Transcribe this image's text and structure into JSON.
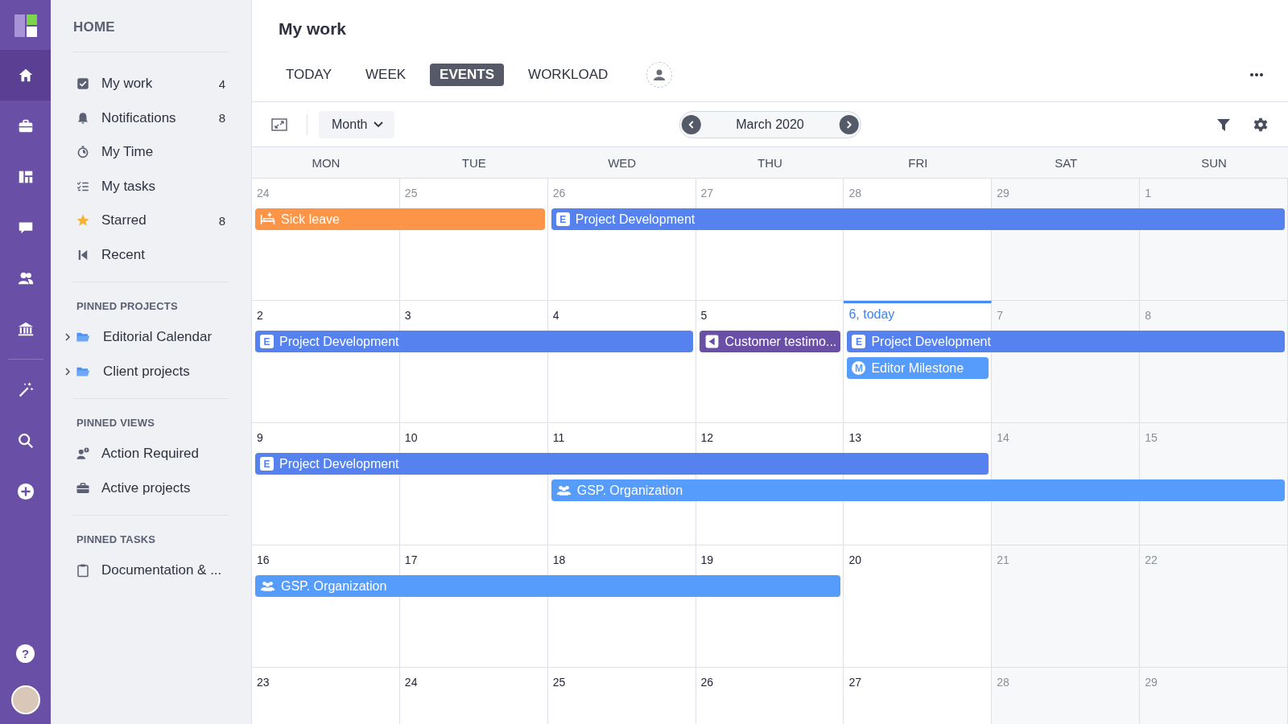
{
  "rail": {
    "items": [
      {
        "selected": true
      },
      {
        "selected": false
      },
      {
        "selected": false
      },
      {
        "selected": false
      },
      {
        "selected": false
      },
      {
        "selected": false
      },
      {
        "selected": false
      },
      {
        "selected": false
      },
      {
        "selected": false
      }
    ],
    "help": "?"
  },
  "sidebar": {
    "sections": [
      {
        "title": "HOME",
        "items": [
          {
            "label": "My work",
            "count": "4"
          },
          {
            "label": "Notifications",
            "count": "8"
          },
          {
            "label": "My Time"
          },
          {
            "label": "My tasks"
          },
          {
            "label": "Starred",
            "count": "8"
          },
          {
            "label": "Recent"
          }
        ]
      },
      {
        "title": "PINNED PROJECTS",
        "items": [
          {
            "label": "Editorial Calendar",
            "expanded": false
          },
          {
            "label": "Client projects",
            "expanded": false
          }
        ]
      },
      {
        "title": "PINNED VIEWS",
        "items": [
          {
            "label": "Action Required"
          },
          {
            "label": "Active projects"
          }
        ]
      },
      {
        "title": "PINNED TASKS",
        "items": [
          {
            "label": "Documentation & ..."
          }
        ]
      }
    ]
  },
  "page": {
    "title": "My work"
  },
  "tabs": [
    {
      "label": "TODAY",
      "selected": false
    },
    {
      "label": "WEEK",
      "selected": false
    },
    {
      "label": "EVENTS",
      "selected": true
    },
    {
      "label": "WORKLOAD",
      "selected": false
    }
  ],
  "toolbar": {
    "view": "Month",
    "period": "March 2020"
  },
  "calendar": {
    "weekdays": [
      "MON",
      "TUE",
      "WED",
      "THU",
      "FRI",
      "SAT",
      "SUN"
    ],
    "weeks": [
      {
        "days": [
          {
            "label": "24",
            "muted": true
          },
          {
            "label": "25",
            "muted": true
          },
          {
            "label": "26",
            "muted": true
          },
          {
            "label": "27",
            "muted": true
          },
          {
            "label": "28",
            "muted": true
          },
          {
            "label": "29",
            "muted": true
          },
          {
            "label": "1",
            "muted": true
          }
        ],
        "lanes": [
          [
            {
              "kind": "leave",
              "title": "Sick leave",
              "color": "#fd9549"
            },
            {
              "kind": "continued"
            },
            {
              "kind": "epic",
              "badge": "E",
              "title": "Project Development",
              "color": "#5582ef"
            },
            {
              "kind": "continued"
            },
            {
              "kind": "continued"
            },
            {
              "kind": "continued"
            },
            {
              "kind": "continued"
            }
          ]
        ]
      },
      {
        "days": [
          {
            "label": "2",
            "muted": false
          },
          {
            "label": "3",
            "muted": false
          },
          {
            "label": "4",
            "muted": false
          },
          {
            "label": "5",
            "muted": false
          },
          {
            "label": "6, today",
            "muted": false,
            "today": true
          },
          {
            "label": "7",
            "muted": true
          },
          {
            "label": "8",
            "muted": true
          }
        ],
        "lanes": [
          [
            {
              "kind": "epic",
              "badge": "E",
              "title": "Project Development",
              "color": "#5582ef"
            },
            {
              "kind": "continued"
            },
            {
              "kind": "continued"
            },
            {
              "kind": "launch",
              "title": "Customer testimo...",
              "color": "#6a4fa6"
            },
            {
              "kind": "epic",
              "badge": "E",
              "title": "Project Development",
              "color": "#5582ef"
            },
            {
              "kind": "continued"
            },
            {
              "kind": "continued"
            }
          ],
          [
            {
              "kind": "empty"
            },
            {
              "kind": "empty"
            },
            {
              "kind": "empty"
            },
            {
              "kind": "empty"
            },
            {
              "kind": "milestone",
              "badge": "M",
              "title": "Editor Milestone",
              "color": "#569cfc"
            },
            {
              "kind": "empty"
            },
            {
              "kind": "empty"
            }
          ]
        ]
      },
      {
        "days": [
          {
            "label": "9",
            "muted": false
          },
          {
            "label": "10",
            "muted": false
          },
          {
            "label": "11",
            "muted": false
          },
          {
            "label": "12",
            "muted": false
          },
          {
            "label": "13",
            "muted": false
          },
          {
            "label": "14",
            "muted": true
          },
          {
            "label": "15",
            "muted": true
          }
        ],
        "lanes": [
          [
            {
              "kind": "epic",
              "badge": "E",
              "title": "Project Development",
              "color": "#5582ef"
            },
            {
              "kind": "continued"
            },
            {
              "kind": "continued"
            },
            {
              "kind": "continued"
            },
            {
              "kind": "continued"
            },
            {
              "kind": "empty"
            },
            {
              "kind": "empty"
            }
          ],
          [
            {
              "kind": "empty"
            },
            {
              "kind": "empty"
            },
            {
              "kind": "team",
              "title": "GSP. Organization",
              "color": "#569cfc"
            },
            {
              "kind": "continued"
            },
            {
              "kind": "continued"
            },
            {
              "kind": "continued"
            },
            {
              "kind": "continued"
            }
          ]
        ]
      },
      {
        "days": [
          {
            "label": "16",
            "muted": false
          },
          {
            "label": "17",
            "muted": false
          },
          {
            "label": "18",
            "muted": false
          },
          {
            "label": "19",
            "muted": false
          },
          {
            "label": "20",
            "muted": false
          },
          {
            "label": "21",
            "muted": true
          },
          {
            "label": "22",
            "muted": true
          }
        ],
        "lanes": [
          [
            {
              "kind": "team",
              "title": "GSP. Organization",
              "color": "#569cfc"
            },
            {
              "kind": "continued"
            },
            {
              "kind": "continued"
            },
            {
              "kind": "continued"
            },
            {
              "kind": "empty"
            },
            {
              "kind": "empty"
            },
            {
              "kind": "empty"
            }
          ]
        ]
      },
      {
        "days": [
          {
            "label": "23",
            "muted": false
          },
          {
            "label": "24",
            "muted": false
          },
          {
            "label": "25",
            "muted": false
          },
          {
            "label": "26",
            "muted": false
          },
          {
            "label": "27",
            "muted": false
          },
          {
            "label": "28",
            "muted": true
          },
          {
            "label": "29",
            "muted": true
          }
        ]
      }
    ]
  }
}
